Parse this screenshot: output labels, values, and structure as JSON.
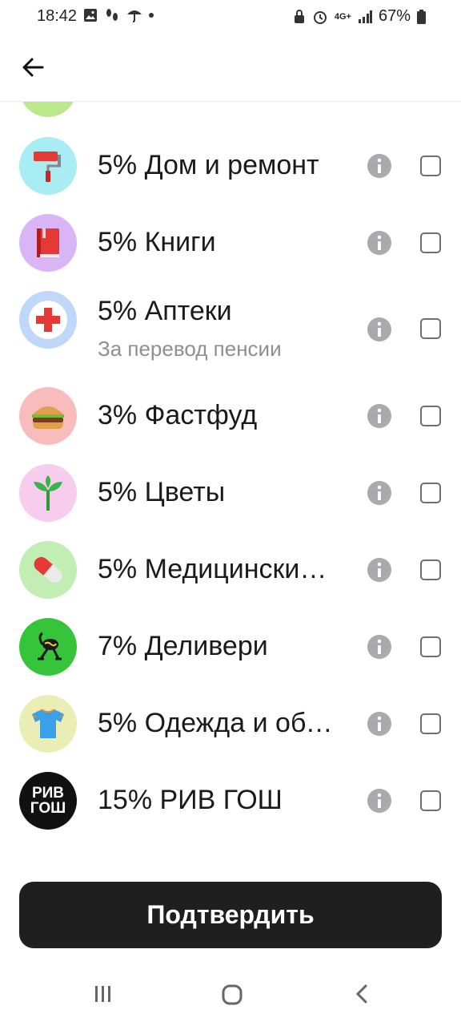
{
  "status": {
    "time": "18:42",
    "network": "4G+",
    "battery": "67%"
  },
  "header": {
    "back_icon": "arrow-left-icon"
  },
  "categories": [
    {
      "title": "5% Дом и ремонт",
      "subtitle": "",
      "icon": "paint-roller-icon",
      "bg": "#A8ECF4"
    },
    {
      "title": "5% Книги",
      "subtitle": "",
      "icon": "book-icon",
      "bg": "#D9B5F6"
    },
    {
      "title": "5% Аптеки",
      "subtitle": "За перевод пенсии",
      "icon": "pharmacy-cross-icon",
      "bg": "#BFD7F8"
    },
    {
      "title": "3% Фастфуд",
      "subtitle": "",
      "icon": "burger-icon",
      "bg": "#F8BCBC"
    },
    {
      "title": "5% Цветы",
      "subtitle": "",
      "icon": "plant-icon",
      "bg": "#F6CDEE"
    },
    {
      "title": "5% Медицински…",
      "subtitle": "",
      "icon": "pill-icon",
      "bg": "#C3EEB3"
    },
    {
      "title": "7% Деливери",
      "subtitle": "",
      "icon": "delivery-logo-icon",
      "bg": "#35C43A"
    },
    {
      "title": "5% Одежда и обу…",
      "subtitle": "",
      "icon": "tshirt-icon",
      "bg": "#EAEDB4"
    },
    {
      "title": "15% РИВ ГОШ",
      "subtitle": "",
      "icon": "rivgosh-logo-icon",
      "bg": "#111111",
      "logo_text": [
        "РИВ",
        "ГОШ"
      ]
    }
  ],
  "actions": {
    "confirm_label": "Подтвердить"
  },
  "navbar": {
    "items": [
      "recent-apps-icon",
      "home-icon",
      "back-icon"
    ]
  }
}
